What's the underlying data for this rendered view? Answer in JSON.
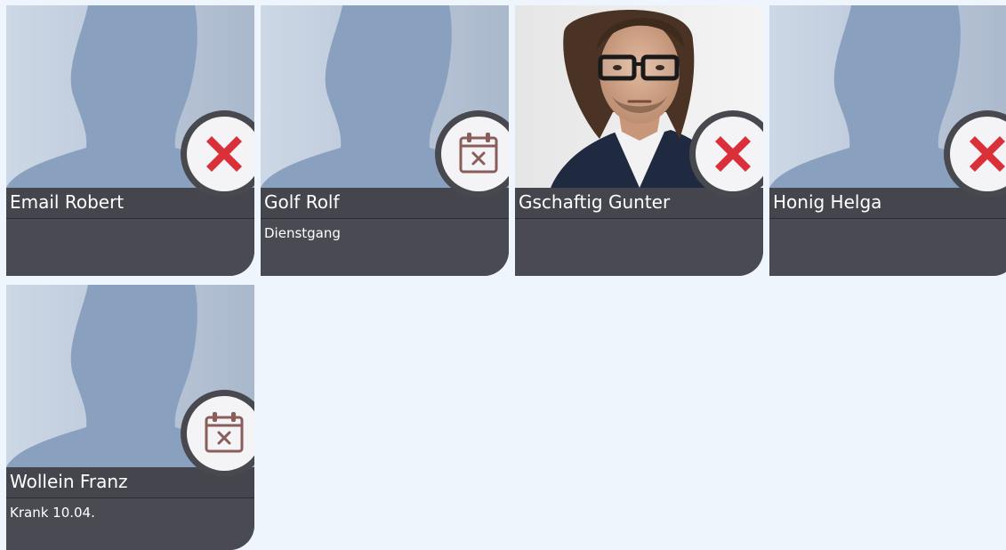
{
  "employees": [
    {
      "name": "Email Robert",
      "status": "",
      "icon": "absent-x-icon",
      "photo": "placeholder-silhouette"
    },
    {
      "name": "Golf Rolf",
      "status": "Dienstgang",
      "icon": "calendar-x-icon",
      "photo": "placeholder-silhouette"
    },
    {
      "name": "Gschaftig Gunter",
      "status": "",
      "icon": "absent-x-icon",
      "photo": "man-with-glasses-photo"
    },
    {
      "name": "Honig Helga",
      "status": "",
      "icon": "absent-x-icon",
      "photo": "placeholder-silhouette"
    },
    {
      "name": "Wollein Franz",
      "status": "Krank 10.04.",
      "icon": "calendar-x-icon",
      "photo": "placeholder-silhouette"
    }
  ],
  "colors": {
    "page_bg": "#eef5fd",
    "card_bg": "#47474f",
    "absent_red": "#d9303a",
    "calendar_brown": "#8a5c5a"
  }
}
